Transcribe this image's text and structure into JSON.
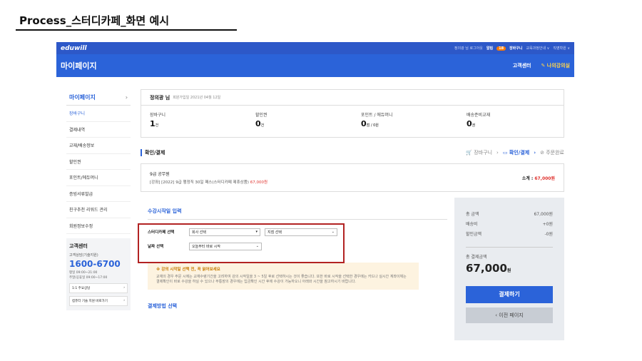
{
  "slide": {
    "title": "Process_스터디카페_화면 예시"
  },
  "topbar": {
    "logo": "eduwill",
    "logout": "정의광 님 로그아웃",
    "alarm_label": "알림",
    "alarm_count": "18",
    "cart": "장바구니",
    "course_info": "교육과정안내 ∨",
    "academy": "직영학원 ∨"
  },
  "navbar": {
    "title": "마이페이지",
    "support": "고객센터",
    "my_class": "나의강의실"
  },
  "sidebar": {
    "header": "마이페이지",
    "items": [
      {
        "label": "장바구니"
      },
      {
        "label": "결제내역"
      },
      {
        "label": "교재/배송정보"
      },
      {
        "label": "할인권"
      },
      {
        "label": "포인트/에듀머니"
      },
      {
        "label": "증빙서류발급"
      },
      {
        "label": "친구추천 리워드 관리"
      },
      {
        "label": "회원정보수정"
      }
    ],
    "cs": {
      "title": "고객센터",
      "sub": "고객상담(기술지원)",
      "phone": "1600-6700",
      "hours1": "평일 09:00~21:00",
      "hours2": "주말/공휴일 09:00~17:00",
      "btn1": "1:1 주요상담",
      "btn2": "컴퓨터 기술 지원 바로가기"
    }
  },
  "user": {
    "name": "정의광 님",
    "joined": "회원가입일 2021년 04월 12일",
    "stats": [
      {
        "label": "장바구니",
        "value": "1",
        "unit": "건"
      },
      {
        "label": "할인권",
        "value": "0",
        "unit": "건"
      },
      {
        "label": "포인트 / 에듀머니",
        "value": "0",
        "unit": "점 / 0원"
      },
      {
        "label": "배송준비교재",
        "value": "0",
        "unit": "권"
      }
    ]
  },
  "steps": {
    "section_label": "확인/결제",
    "step1": "장바구니",
    "step2": "확인/결제",
    "step3": "주문완료"
  },
  "order": {
    "category": "9급 공무원",
    "name": "[강좌] [2022] 9급 행정직 30일 패스(스터디카페 제휴상품)",
    "price": "67,000원",
    "subtotal_label": "소계 :",
    "subtotal": "67,000원"
  },
  "form": {
    "section_title": "수강시작일 입력",
    "cafe_label": "스터디카페 선택",
    "company_placeholder": "회사 선택",
    "branch_placeholder": "지점 선택",
    "date_label": "날짜 선택",
    "date_value": "오늘부터 바로 시작",
    "notice_title": "※ 강의 시작일 선택 전, 꼭 읽어보세요",
    "notice_body": "교재의 경우 주문 시에는 교재수령기간을 고려하여 강의 시작일을 3 ~ 5일 후로 선택하시는 것이 좋습니다. 또한 바로 시작을 선택한 경우에는 카드나 실시간 계좌이체는 결제확인이 바로 수강을 하실 수 있으나 무통장의 경우에는 입금확인 시간 후에 수강이 가능하오니 아래와 시간을 참고하시기 바랍니다.",
    "pay_method_title": "결제방법 선택"
  },
  "summary": {
    "rows": [
      {
        "label": "총 금액",
        "value": "67,000원"
      },
      {
        "label": "배송비",
        "value": "+0원"
      },
      {
        "label": "할인금액",
        "value": "-0원"
      }
    ],
    "total_label": "총 결제금액",
    "total_value": "67,000",
    "total_unit": "원",
    "pay_button": "결제하기",
    "prev_button": "‹ 이전 페이지"
  }
}
